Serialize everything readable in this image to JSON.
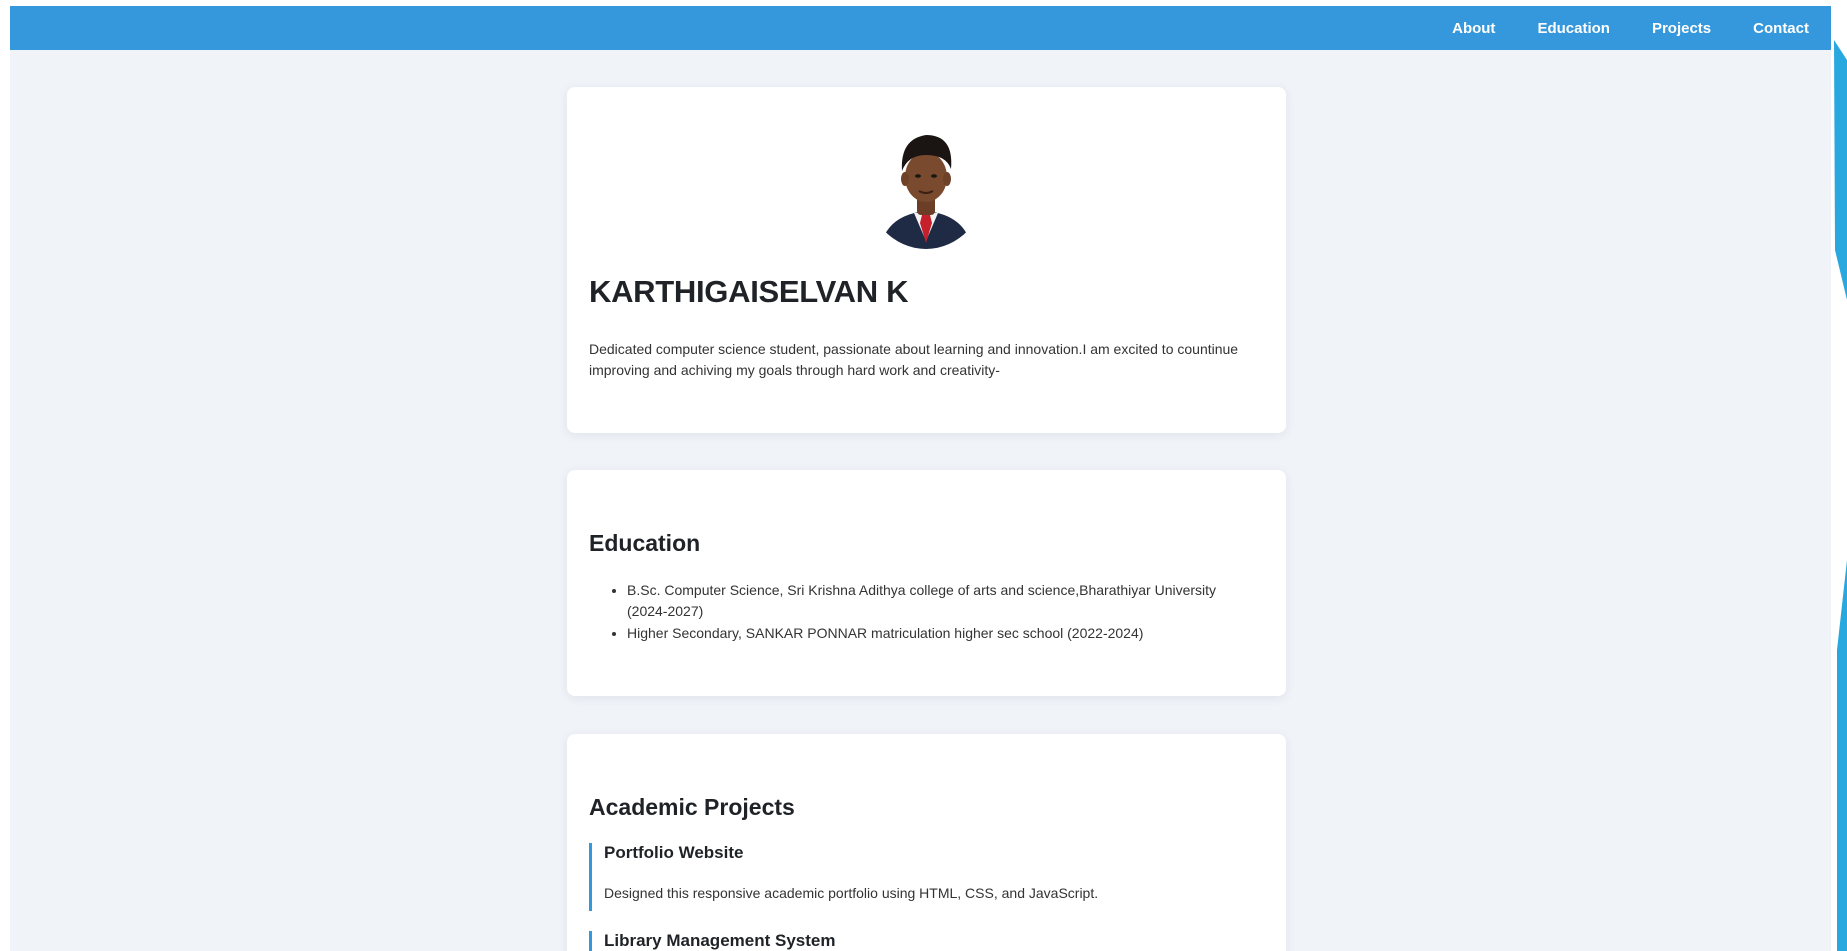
{
  "nav": {
    "links": [
      "About",
      "Education",
      "Projects",
      "Contact"
    ]
  },
  "colors": {
    "accent": "#3598dc",
    "background": "#f0f3f8"
  },
  "about": {
    "avatar_icon": "profile-photo",
    "name": "KARTHIGAISELVAN K",
    "bio": "Dedicated computer science student, passionate about learning and innovation.I am excited to countinue improving and achiving my goals through hard work and creativity-"
  },
  "education": {
    "title": "Education",
    "items": [
      "B.Sc. Computer Science, Sri Krishna Adithya college of arts and science,Bharathiyar University (2024-2027)",
      "Higher Secondary, SANKAR PONNAR matriculation higher sec school (2022-2024)"
    ]
  },
  "projects": {
    "title": "Academic Projects",
    "items": [
      {
        "name": "Portfolio Website",
        "description": "Designed this responsive academic portfolio using HTML, CSS, and JavaScript."
      },
      {
        "name": "Library Management System",
        "description": ""
      }
    ]
  }
}
